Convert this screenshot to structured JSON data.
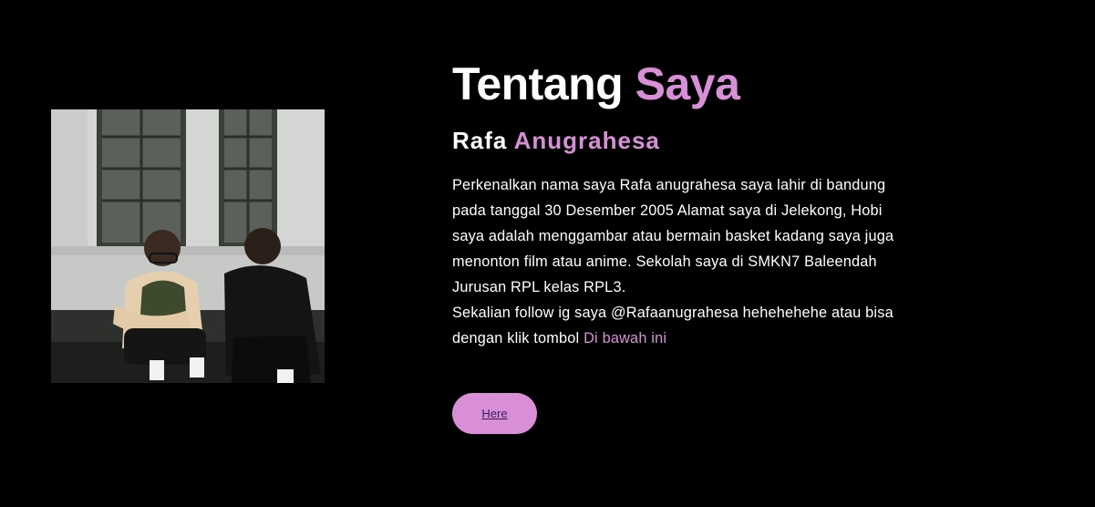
{
  "about": {
    "title_main": "Tentang",
    "title_accent": "Saya",
    "name_first": "Rafa",
    "name_last": "Anugrahesa",
    "bio_lines": [
      "Perkenalkan nama saya Rafa anugrahesa saya lahir di bandung",
      "pada tanggal 30 Desember 2005 Alamat saya di Jelekong, Hobi",
      "saya adalah menggambar atau bermain basket kadang saya juga",
      "menonton film atau anime. Sekolah saya di SMKN7 Baleendah",
      "Jurusan RPL kelas RPL3.",
      "Sekalian follow ig saya @Rafaanugrahesa hehehehehe atau bisa"
    ],
    "bio_last_prefix": "dengan klik tombol",
    "bio_last_link": "Di bawah ini",
    "button_label": "Here"
  },
  "photo": {
    "icon": "profile-photo"
  },
  "colors": {
    "background": "#000000",
    "text": "#ffffff",
    "accent": "#d98fd8",
    "button_text": "#3b1a5a"
  }
}
